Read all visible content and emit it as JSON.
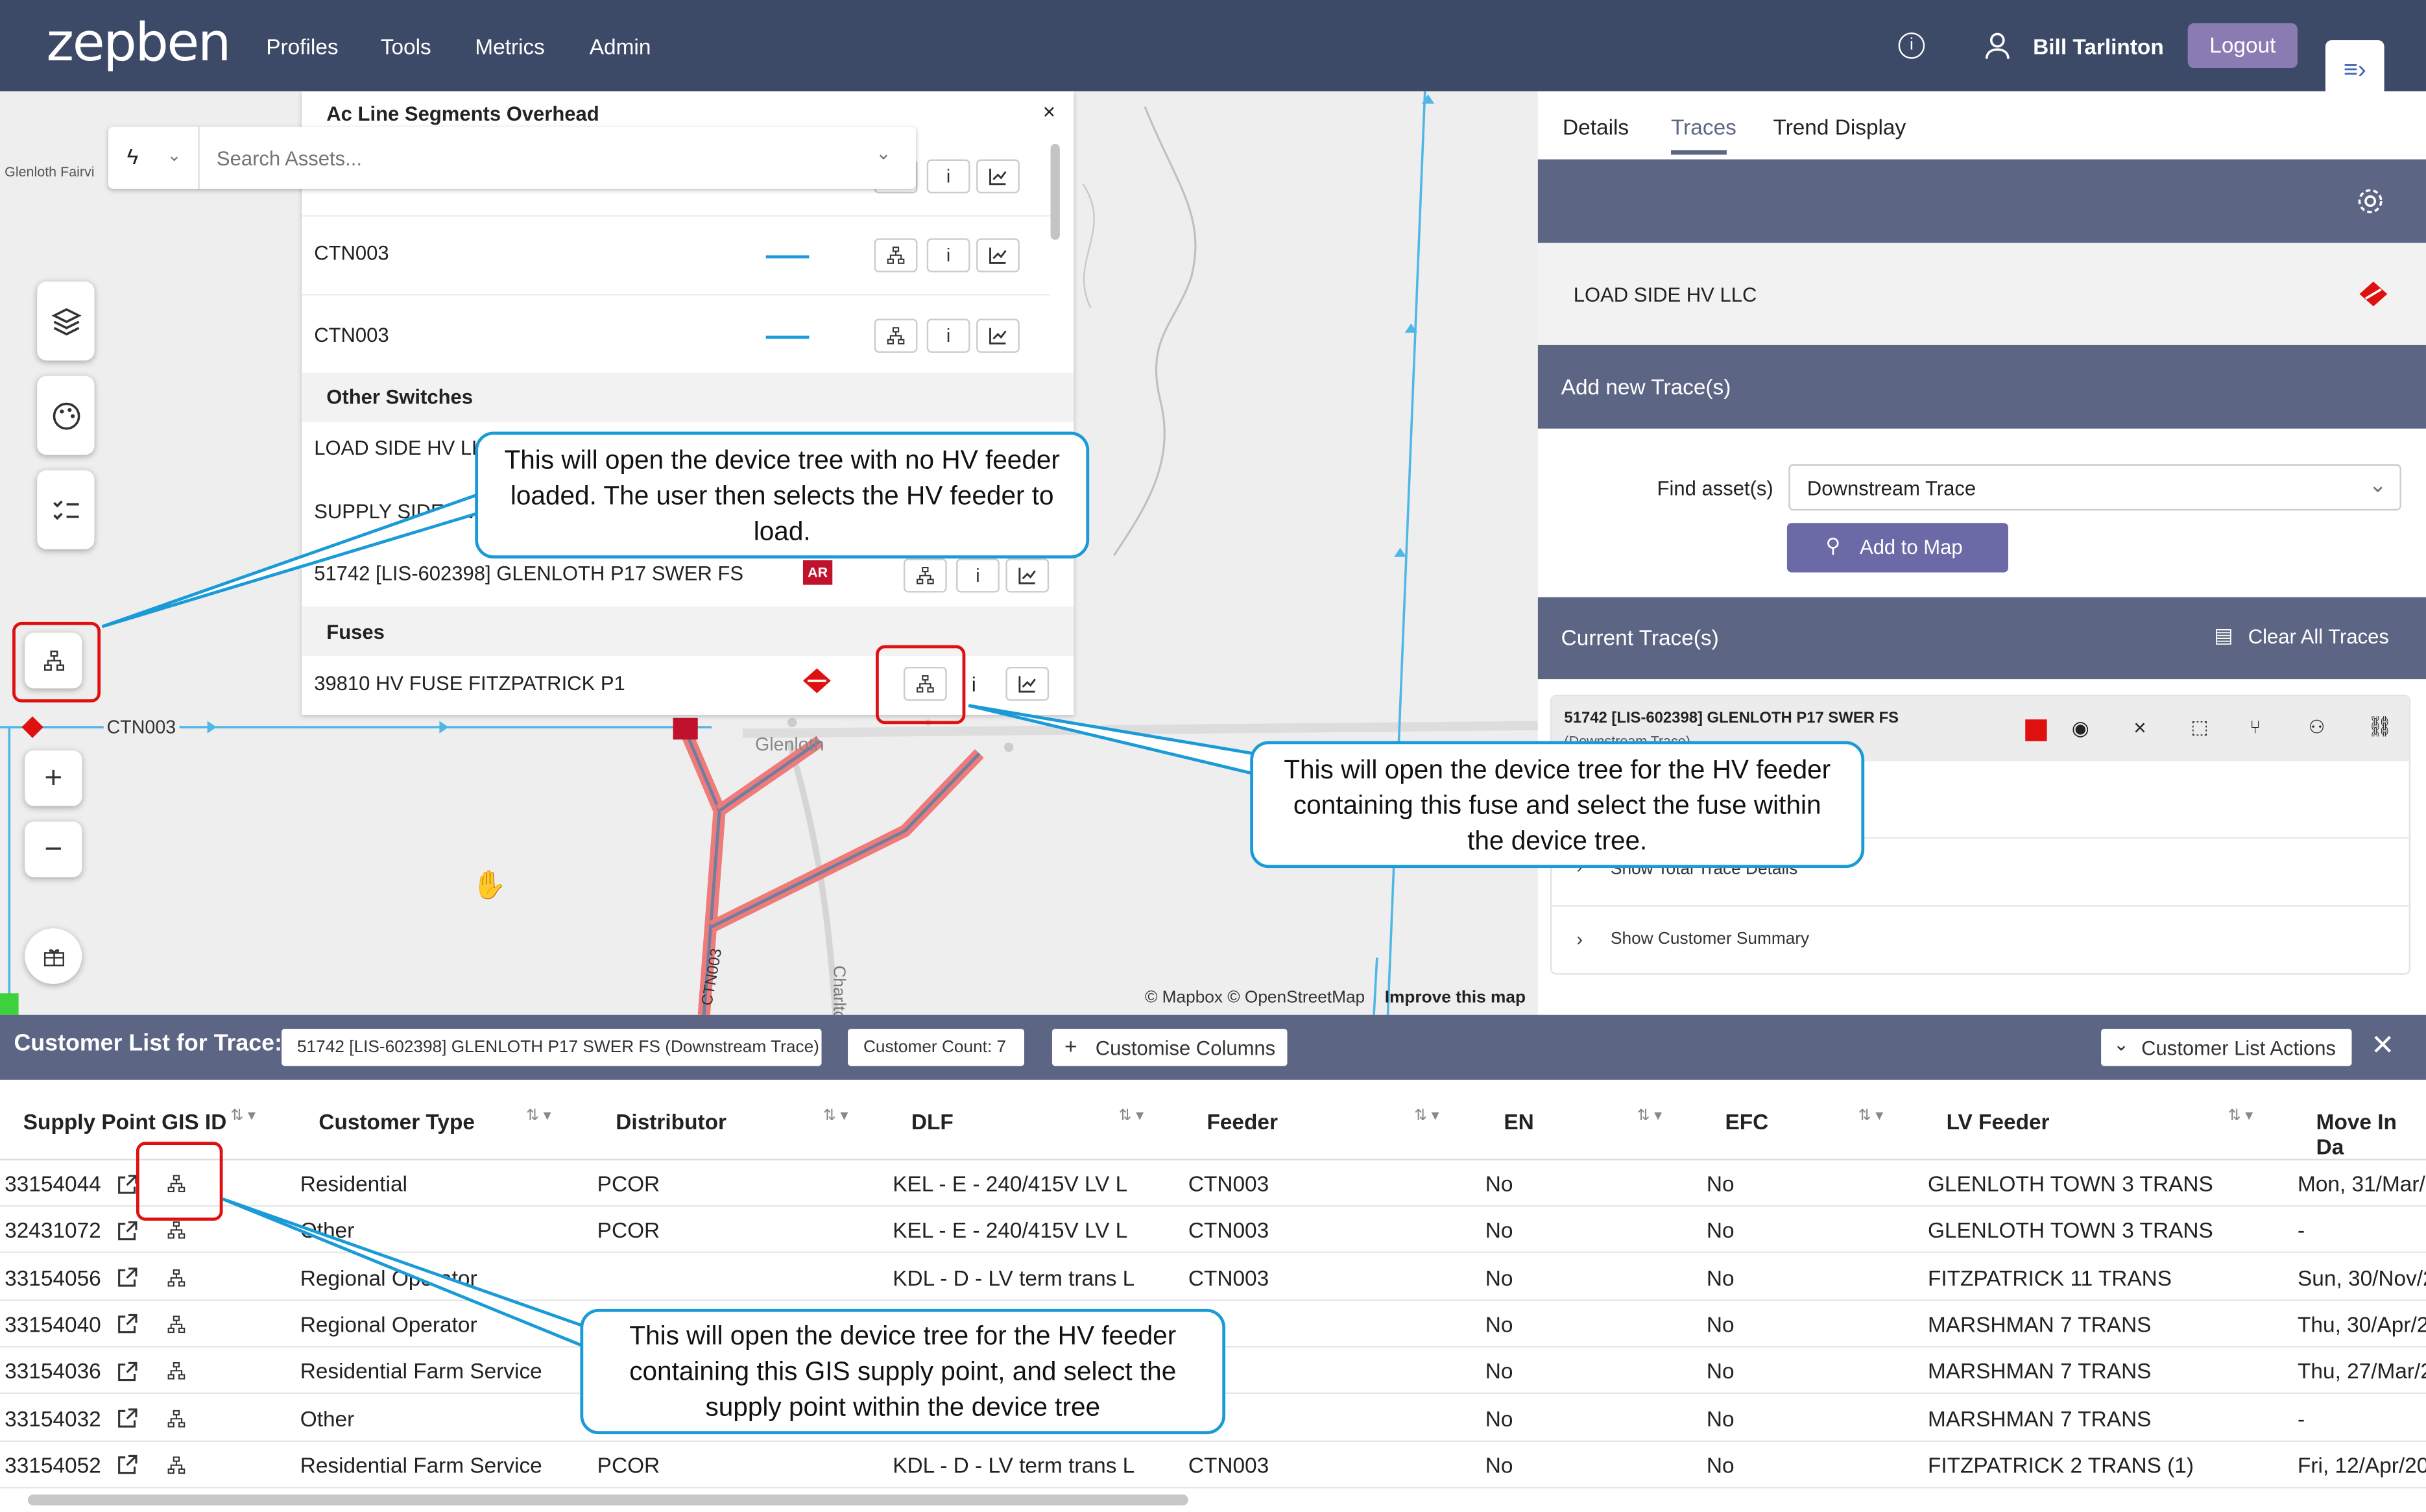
{
  "app": {
    "logo": "zepben",
    "nav": [
      "Profiles",
      "Tools",
      "Metrics",
      "Admin"
    ],
    "user": "Bill Tarlinton",
    "logout": "Logout"
  },
  "map": {
    "place_label": "Glenloth Fairvi",
    "town_label": "Glenloth",
    "road_label": "Charlto",
    "feeder_label": "CTN003",
    "feeder_label_vertical": "CTN003",
    "attribution": "© Mapbox © OpenStreetMap",
    "improve": "Improve this map"
  },
  "search": {
    "placeholder": "Search Assets..."
  },
  "asset_panel": {
    "title": "Ac Line Segments Overhead",
    "rows": [
      {
        "name": "CTN003"
      },
      {
        "name": "CTN003"
      }
    ],
    "switch_section": "Other Switches",
    "switches": [
      "LOAD SIDE HV LLC",
      "SUPPLY SIDE HV",
      "51742 [LIS-602398] GLENLOTH P17 SWER FS"
    ],
    "ar_badge": "AR",
    "fuse_section": "Fuses",
    "fuse": "39810 HV FUSE FITZPATRICK P1",
    "info_glyph": "i"
  },
  "right_panel": {
    "tabs": [
      "Details",
      "Traces",
      "Trend Display"
    ],
    "active_tab": "Traces",
    "selected_asset": "LOAD SIDE HV LLC",
    "add_section": "Add new Trace(s)",
    "find_label": "Find asset(s)",
    "find_value": "Downstream Trace",
    "add_btn": "Add to Map",
    "current_section": "Current Trace(s)",
    "clear_btn": "Clear All Traces",
    "trace_name": "51742 [LIS-602398] GLENLOTH P17 SWER FS",
    "trace_sub": "(Downstream Trace)",
    "trace_color": "#e01010",
    "show_total": "Show Total Trace Details",
    "show_customer": "Show Customer Summary"
  },
  "customer_list": {
    "title": "Customer List for Trace:",
    "trace": "51742 [LIS-602398] GLENLOTH P17 SWER FS (Downstream Trace)",
    "count": "Customer Count: 7",
    "customise": "Customise Columns",
    "actions": "Customer List Actions",
    "columns": [
      "Supply Point GIS ID",
      "Customer Type",
      "Distributor",
      "DLF",
      "Feeder",
      "EN",
      "EFC",
      "LV Feeder",
      "Move In Da"
    ],
    "rows": [
      [
        "33154044",
        "Residential",
        "PCOR",
        "KEL - E - 240/415V LV L",
        "CTN003",
        "No",
        "No",
        "GLENLOTH TOWN 3 TRANS",
        "Mon, 31/Mar/"
      ],
      [
        "32431072",
        "Other",
        "PCOR",
        "KEL - E - 240/415V LV L",
        "CTN003",
        "No",
        "No",
        "GLENLOTH TOWN 3 TRANS",
        "-"
      ],
      [
        "33154056",
        "Regional Operator",
        "",
        "KDL - D - LV term trans L",
        "CTN003",
        "No",
        "No",
        "FITZPATRICK 11 TRANS",
        "Sun, 30/Nov/2"
      ],
      [
        "33154040",
        "Regional Operator",
        "",
        "",
        "003",
        "No",
        "No",
        "MARSHMAN 7 TRANS",
        "Thu, 30/Apr/2"
      ],
      [
        "33154036",
        "Residential Farm Service",
        "",
        "",
        "003",
        "No",
        "No",
        "MARSHMAN 7 TRANS",
        "Thu, 27/Mar/2"
      ],
      [
        "33154032",
        "Other",
        "",
        "",
        "003",
        "No",
        "No",
        "MARSHMAN 7 TRANS",
        "-"
      ],
      [
        "33154052",
        "Residential Farm Service",
        "PCOR",
        "KDL - D - LV term trans L",
        "CTN003",
        "No",
        "No",
        "FITZPATRICK 2 TRANS (1)",
        "Fri, 12/Apr/20"
      ]
    ]
  },
  "callouts": {
    "c1": "This will open the device tree with no HV feeder loaded. The user then selects the HV feeder to load.",
    "c2": "This will open the device tree for the HV feeder containing this fuse and select the fuse within the device tree.",
    "c3": "This will open the device tree for the HV feeder containing this GIS supply point, and select the supply point within the device tree"
  },
  "colors": {
    "topbar": "#3d4a67",
    "accent": "#8a7bb3",
    "section_bar": "#5d6584",
    "callout_border": "#1a9bd7",
    "highlight": "#e01010"
  }
}
